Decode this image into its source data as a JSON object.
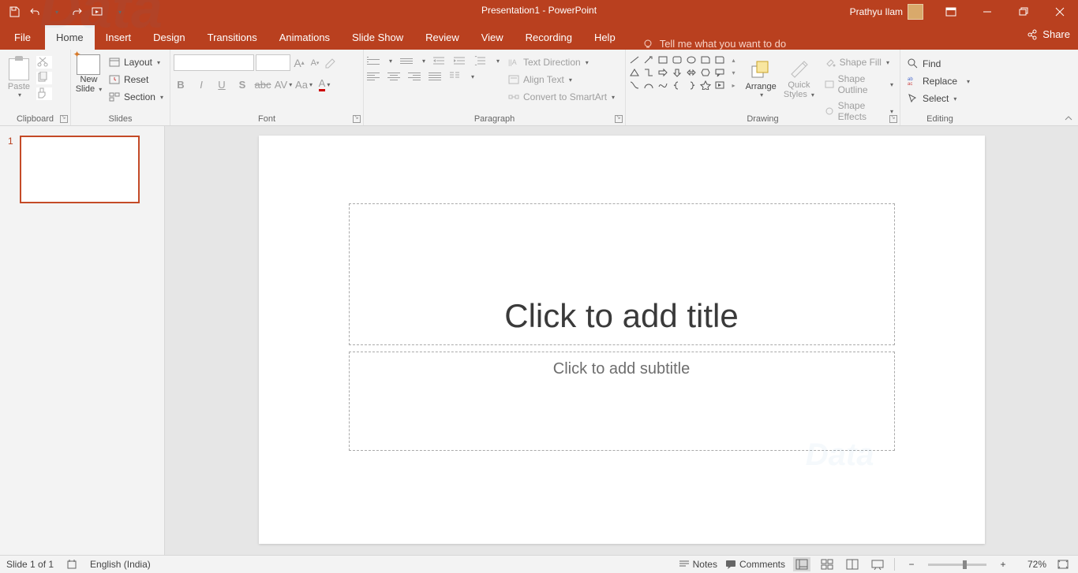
{
  "titlebar": {
    "title": "Presentation1  -  PowerPoint",
    "user": "Prathyu Ilam"
  },
  "tabs": {
    "file": "File",
    "home": "Home",
    "insert": "Insert",
    "design": "Design",
    "transitions": "Transitions",
    "animations": "Animations",
    "slideshow": "Slide Show",
    "review": "Review",
    "view": "View",
    "recording": "Recording",
    "help": "Help",
    "tellme": "Tell me what you want to do",
    "share": "Share"
  },
  "ribbon": {
    "clipboard": {
      "paste": "Paste",
      "label": "Clipboard"
    },
    "slides": {
      "newslide1": "New",
      "newslide2": "Slide",
      "layout": "Layout",
      "reset": "Reset",
      "section": "Section",
      "label": "Slides"
    },
    "font": {
      "label": "Font"
    },
    "paragraph": {
      "textdir": "Text Direction",
      "align": "Align Text",
      "smartart": "Convert to SmartArt",
      "label": "Paragraph"
    },
    "drawing": {
      "arrange": "Arrange",
      "quick1": "Quick",
      "quick2": "Styles",
      "fill": "Shape Fill",
      "outline": "Shape Outline",
      "effects": "Shape Effects",
      "label": "Drawing"
    },
    "editing": {
      "find": "Find",
      "replace": "Replace",
      "select": "Select",
      "label": "Editing"
    }
  },
  "thumbs": {
    "n1": "1"
  },
  "slide": {
    "title_placeholder": "Click to add title",
    "subtitle_placeholder": "Click to add subtitle"
  },
  "status": {
    "slide": "Slide 1 of 1",
    "lang": "English (India)",
    "notes": "Notes",
    "comments": "Comments",
    "zoom": "72%"
  }
}
